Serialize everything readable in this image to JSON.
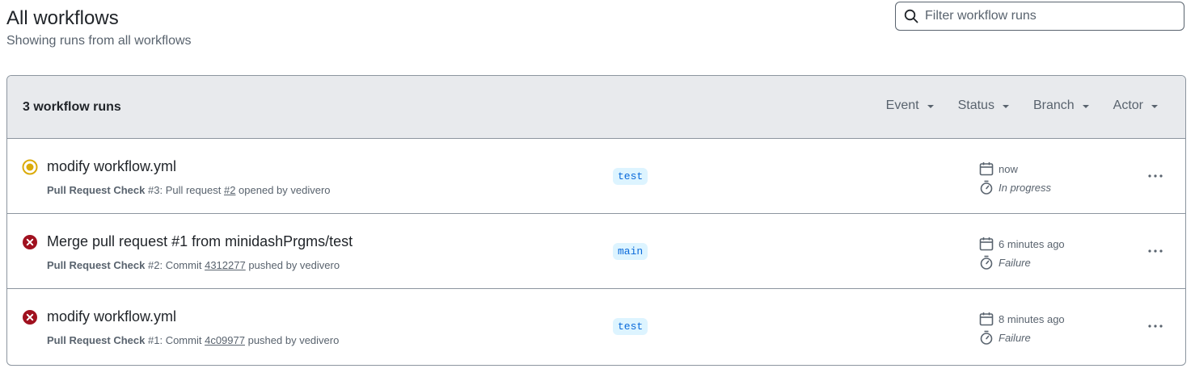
{
  "header": {
    "title": "All workflows",
    "subtitle": "Showing runs from all workflows"
  },
  "search": {
    "placeholder": "Filter workflow runs",
    "value": ""
  },
  "runs_box": {
    "count_label": "3 workflow runs",
    "filters": [
      "Event",
      "Status",
      "Branch",
      "Actor"
    ]
  },
  "runs": [
    {
      "status": "in-progress",
      "status_color": "#bf8700",
      "title": "modify workflow.yml",
      "workflow": "Pull Request Check",
      "run_number": "#3",
      "trigger_text": ": Pull request ",
      "ref": "#2",
      "suffix": " opened by vedivero",
      "branch": "test",
      "when": "now",
      "duration": "In progress"
    },
    {
      "status": "failure",
      "status_color": "#cf222e",
      "title": "Merge pull request #1 from minidashPrgms/test",
      "workflow": "Pull Request Check",
      "run_number": "#2",
      "trigger_text": ": Commit ",
      "ref": "4312277",
      "suffix": " pushed by vedivero",
      "branch": "main",
      "when": "6 minutes ago",
      "duration": "Failure"
    },
    {
      "status": "failure",
      "status_color": "#cf222e",
      "title": "modify workflow.yml",
      "workflow": "Pull Request Check",
      "run_number": "#1",
      "trigger_text": ": Commit ",
      "ref": "4c09977",
      "suffix": " pushed by vedivero",
      "branch": "test",
      "when": "8 minutes ago",
      "duration": "Failure"
    }
  ]
}
